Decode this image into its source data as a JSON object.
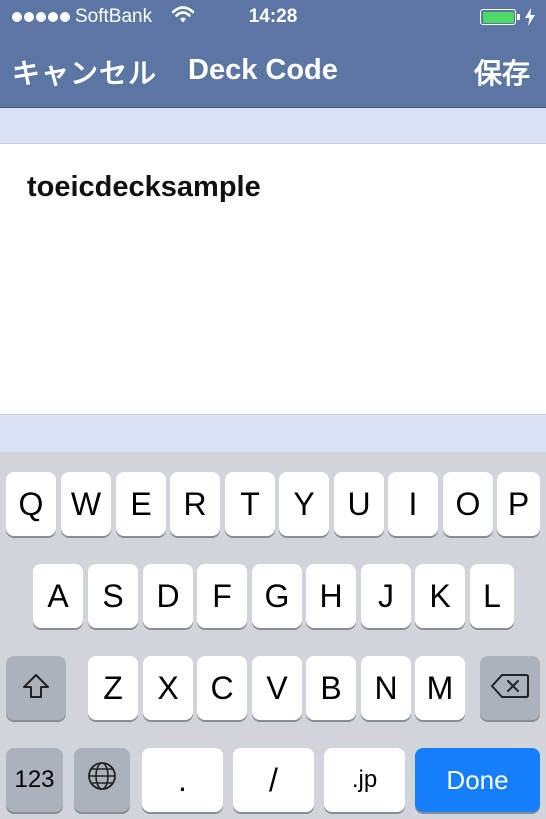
{
  "status_bar": {
    "carrier": "SoftBank",
    "time": "14:28",
    "battery_color": "#4cd964",
    "icons": [
      "signal-dots-icon",
      "wifi-icon",
      "battery-icon",
      "charging-bolt-icon"
    ]
  },
  "nav": {
    "cancel_label": "キャンセル",
    "title": "Deck Code",
    "save_label": "保存",
    "bar_color": "#5b76a3"
  },
  "editor": {
    "value": "toeicdecksample"
  },
  "keyboard": {
    "row1": [
      "Q",
      "W",
      "E",
      "R",
      "T",
      "Y",
      "U",
      "I",
      "O",
      "P"
    ],
    "row2": [
      "A",
      "S",
      "D",
      "F",
      "G",
      "H",
      "J",
      "K",
      "L"
    ],
    "row3": [
      "Z",
      "X",
      "C",
      "V",
      "B",
      "N",
      "M"
    ],
    "numbers_label": "123",
    "period_label": ".",
    "slash_label": "/",
    "jp_label": ".jp",
    "done_label": "Done",
    "done_color": "#157efb"
  }
}
